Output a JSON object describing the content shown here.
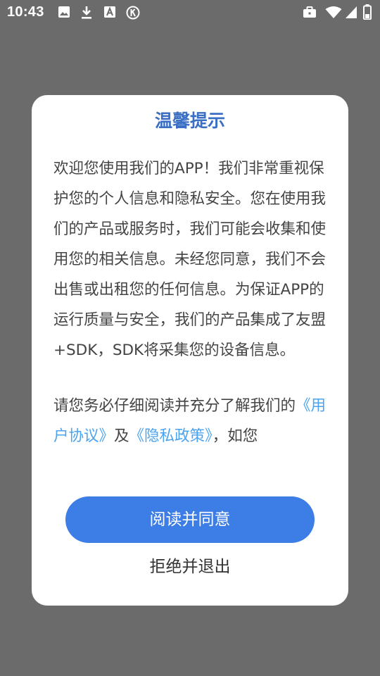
{
  "status_bar": {
    "time": "10:43",
    "left_icons": [
      "image-icon",
      "download-icon",
      "a-box-icon",
      "k-circle-icon"
    ],
    "right_icons": [
      "briefcase-icon",
      "wifi-icon",
      "signal-icon",
      "battery-icon"
    ]
  },
  "dialog": {
    "title": "温馨提示",
    "paragraph1": "欢迎您使用我们的APP！我们非常重视保护您的个人信息和隐私安全。您在使用我们的产品或服务时，我们可能会收集和使用您的相关信息。未经您同意，我们不会出售或出租您的任何信息。为保证APP的运行质量与安全，我们的产品集成了友盟+SDK，SDK将采集您的设备信息。",
    "paragraph2_prefix": "请您务必仔细阅读并充分了解我们的",
    "user_agreement_link": "《用户协议》",
    "conjunction": "及",
    "privacy_policy_link": "《隐私政策》",
    "paragraph2_suffix": "，如您",
    "agree_button": "阅读并同意",
    "decline_button": "拒绝并退出"
  },
  "colors": {
    "overlay": "#6b6b6b",
    "title": "#3a6fc4",
    "primary_button": "#3c7de6",
    "link": "#4aa3f0"
  }
}
